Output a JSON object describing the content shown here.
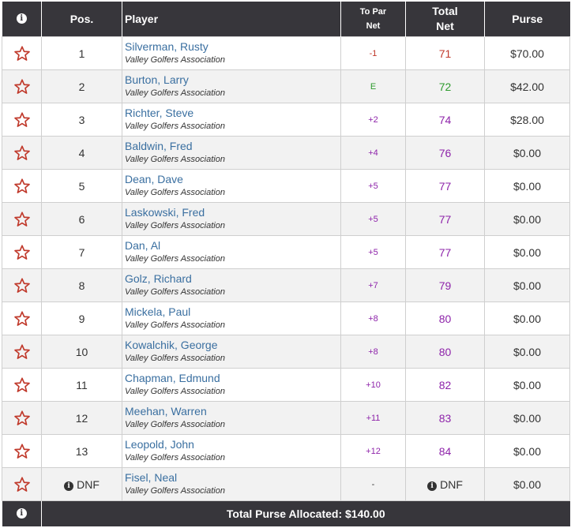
{
  "colors": {
    "header_bg": "#37363b",
    "player_link": "#3a6fa0",
    "under_par": "#c0392b",
    "even_par": "#2e9b2e",
    "over_par": "#8e24aa",
    "star_outline": "#c0392b"
  },
  "header": {
    "info_icon": "info-icon",
    "pos": "Pos.",
    "player": "Player",
    "to_par_line1": "To Par",
    "to_par_line2": "Net",
    "total_line1": "Total",
    "total_line2": "Net",
    "purse": "Purse"
  },
  "rows": [
    {
      "pos": "1",
      "player": "Silverman, Rusty",
      "club": "Valley Golfers Association",
      "to_par": "-1",
      "total": "71",
      "purse": "$70.00",
      "status": "under"
    },
    {
      "pos": "2",
      "player": "Burton, Larry",
      "club": "Valley Golfers Association",
      "to_par": "E",
      "total": "72",
      "purse": "$42.00",
      "status": "even"
    },
    {
      "pos": "3",
      "player": "Richter, Steve",
      "club": "Valley Golfers Association",
      "to_par": "+2",
      "total": "74",
      "purse": "$28.00",
      "status": "over"
    },
    {
      "pos": "4",
      "player": "Baldwin, Fred",
      "club": "Valley Golfers Association",
      "to_par": "+4",
      "total": "76",
      "purse": "$0.00",
      "status": "over"
    },
    {
      "pos": "5",
      "player": "Dean, Dave",
      "club": "Valley Golfers Association",
      "to_par": "+5",
      "total": "77",
      "purse": "$0.00",
      "status": "over"
    },
    {
      "pos": "6",
      "player": "Laskowski, Fred",
      "club": "Valley Golfers Association",
      "to_par": "+5",
      "total": "77",
      "purse": "$0.00",
      "status": "over"
    },
    {
      "pos": "7",
      "player": "Dan, Al",
      "club": "Valley Golfers Association",
      "to_par": "+5",
      "total": "77",
      "purse": "$0.00",
      "status": "over"
    },
    {
      "pos": "8",
      "player": "Golz, Richard",
      "club": "Valley Golfers Association",
      "to_par": "+7",
      "total": "79",
      "purse": "$0.00",
      "status": "over"
    },
    {
      "pos": "9",
      "player": "Mickela, Paul",
      "club": "Valley Golfers Association",
      "to_par": "+8",
      "total": "80",
      "purse": "$0.00",
      "status": "over"
    },
    {
      "pos": "10",
      "player": "Kowalchik, George",
      "club": "Valley Golfers Association",
      "to_par": "+8",
      "total": "80",
      "purse": "$0.00",
      "status": "over"
    },
    {
      "pos": "11",
      "player": "Chapman, Edmund",
      "club": "Valley Golfers Association",
      "to_par": "+10",
      "total": "82",
      "purse": "$0.00",
      "status": "over"
    },
    {
      "pos": "12",
      "player": "Meehan, Warren",
      "club": "Valley Golfers Association",
      "to_par": "+11",
      "total": "83",
      "purse": "$0.00",
      "status": "over"
    },
    {
      "pos": "13",
      "player": "Leopold, John",
      "club": "Valley Golfers Association",
      "to_par": "+12",
      "total": "84",
      "purse": "$0.00",
      "status": "over"
    },
    {
      "pos": "DNF",
      "player": "Fisel, Neal",
      "club": "Valley Golfers Association",
      "to_par": "-",
      "total": "DNF",
      "purse": "$0.00",
      "status": "dnf"
    }
  ],
  "footer": {
    "info_icon": "info-icon",
    "total_purse": "Total Purse Allocated: $140.00"
  },
  "icons": {
    "favorite": "star-outline-icon",
    "info": "info-icon"
  }
}
